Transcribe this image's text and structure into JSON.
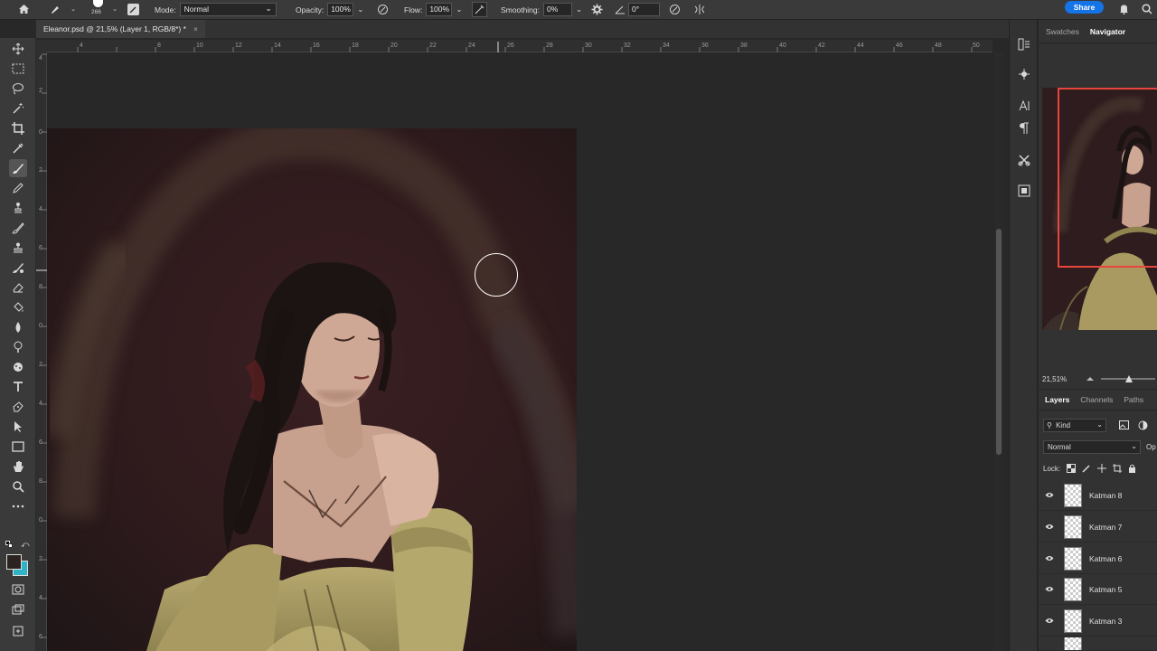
{
  "options_bar": {
    "brush_size": "266",
    "mode_label": "Mode:",
    "mode_value": "Normal",
    "opacity_label": "Opacity:",
    "opacity_value": "100%",
    "flow_label": "Flow:",
    "flow_value": "100%",
    "smoothing_label": "Smoothing:",
    "smoothing_value": "0%",
    "angle_value": "0°",
    "share_label": "Share"
  },
  "document_tab": {
    "title": "Eleanor.psd @ 21,5% (Layer 1, RGB/8*) *",
    "close": "×"
  },
  "ruler": {
    "h_ticks": [
      "4",
      "6",
      "8",
      "10",
      "12",
      "14",
      "16",
      "18",
      "20",
      "22",
      "24",
      "26",
      "28",
      "30",
      "32",
      "34",
      "36",
      "38",
      "40",
      "42",
      "44",
      "46",
      "48",
      "50"
    ],
    "v_ticks": [
      "4",
      "2",
      "0",
      "2",
      "4",
      "6",
      "8",
      "0",
      "2",
      "4",
      "6",
      "8",
      "0",
      "2",
      "4",
      "6",
      "8"
    ]
  },
  "navigator_panel": {
    "tabs": [
      "Swatches",
      "Navigator"
    ],
    "active_tab": "Navigator",
    "zoom_value": "21,51%"
  },
  "layers_panel": {
    "tabs": [
      "Layers",
      "Channels",
      "Paths"
    ],
    "filter_kind": "Kind",
    "blend_mode": "Normal",
    "opacity_short": "Op",
    "lock_label": "Lock:",
    "layers": [
      {
        "name": "Katman 8"
      },
      {
        "name": "Katman 7"
      },
      {
        "name": "Katman 6"
      },
      {
        "name": "Katman 5"
      },
      {
        "name": "Katman 3"
      }
    ]
  },
  "colors": {
    "foreground": "#2b2320",
    "background": "#2fb4c7",
    "share_button": "#1473e6",
    "nav_view_box": "#e8453c"
  }
}
